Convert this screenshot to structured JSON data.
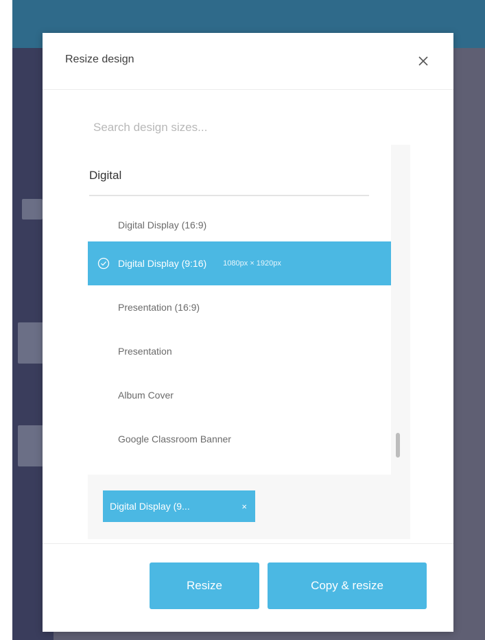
{
  "modal": {
    "title": "Resize design",
    "close_icon": "close-icon"
  },
  "search": {
    "placeholder": "Search design sizes..."
  },
  "list": {
    "category": "Digital",
    "items": [
      {
        "label": "Digital Display (16:9)",
        "selected": false,
        "dims": ""
      },
      {
        "label": "Digital Display (9:16)",
        "selected": true,
        "dims": "1080px × 1920px"
      },
      {
        "label": "Presentation (16:9)",
        "selected": false,
        "dims": ""
      },
      {
        "label": "Presentation",
        "selected": false,
        "dims": ""
      },
      {
        "label": "Album Cover",
        "selected": false,
        "dims": ""
      },
      {
        "label": "Google Classroom Banner",
        "selected": false,
        "dims": ""
      }
    ]
  },
  "selection": {
    "chip_label": "Digital Display (9...",
    "chip_remove": "×"
  },
  "buttons": {
    "resize": "Resize",
    "copy_resize": "Copy & resize"
  },
  "colors": {
    "accent": "#4bb8e3"
  }
}
